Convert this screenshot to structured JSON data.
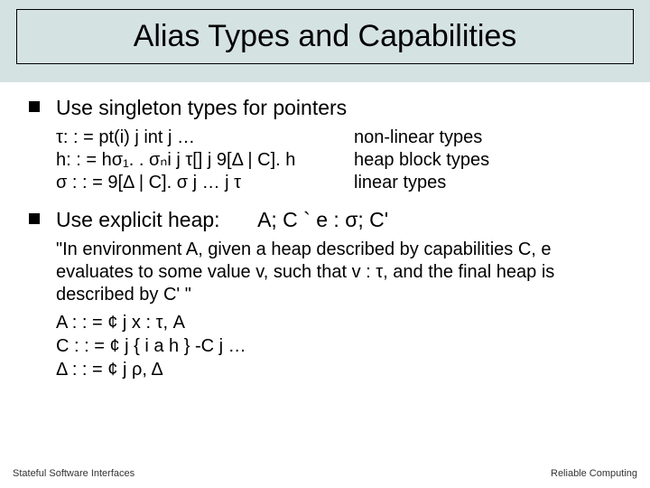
{
  "title": "Alias Types and Capabilities",
  "bullet1": "Use singleton types for pointers",
  "grammar": [
    {
      "lhs": "τ: : = pt(i) j int j …",
      "rhs": "non-linear types"
    },
    {
      "lhs": "h: : = hσ₁. . σₙi j τ[] j 9[Δ | C]. h",
      "rhs": "heap block types"
    },
    {
      "lhs": "σ : : = 9[Δ | C]. σ j … j τ",
      "rhs": "linear types"
    }
  ],
  "bullet2_left": "Use explicit heap:",
  "bullet2_right": "A; C ` e : σ; C'",
  "quote": "\"In environment A, given a heap described by capabilities C, e evaluates to some value v, such that v : τ, and the final heap is described by C' \"",
  "defs": [
    "A : : = ¢ j x : τ, A",
    "C : : = ¢ j { i a h } -C j …",
    "Δ : : = ¢ j ρ, Δ"
  ],
  "footer_left": "Stateful Software Interfaces",
  "footer_right": "Reliable Computing"
}
